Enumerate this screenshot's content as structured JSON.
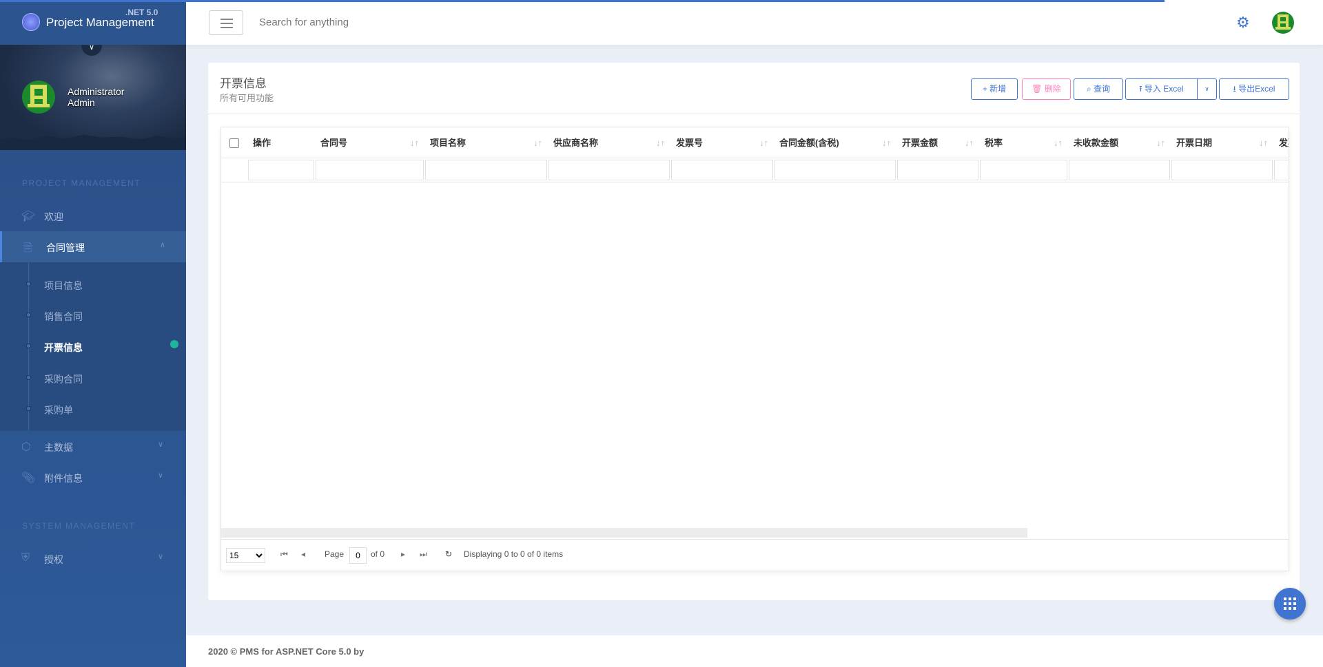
{
  "brand": {
    "title": "Project Management",
    "version": ".NET 5.0"
  },
  "user": {
    "name": "Administrator",
    "role": "Admin"
  },
  "sidebar": {
    "section1": "PROJECT MANAGEMENT",
    "section2": "SYSTEM MANAGEMENT",
    "items": [
      {
        "label": "欢迎",
        "icon": "graduation-cap-icon"
      },
      {
        "label": "合同管理",
        "icon": "file-icon"
      },
      {
        "label": "主数据",
        "icon": "cubes-icon"
      },
      {
        "label": "附件信息",
        "icon": "paperclip-icon"
      },
      {
        "label": "授权",
        "icon": "shield-icon"
      }
    ],
    "subitems": [
      {
        "label": "项目信息"
      },
      {
        "label": "销售合同"
      },
      {
        "label": "开票信息"
      },
      {
        "label": "采购合同"
      },
      {
        "label": "采购单"
      }
    ]
  },
  "topbar": {
    "search_placeholder": "Search for anything"
  },
  "page": {
    "title": "开票信息",
    "subtitle": "所有可用功能"
  },
  "toolbar": {
    "add": "新增",
    "delete": "删除",
    "query": "查询",
    "import": "导入 Excel",
    "export": "导出Excel"
  },
  "table": {
    "columns": [
      "操作",
      "合同号",
      "项目名称",
      "供应商名称",
      "发票号",
      "合同金额(含税)",
      "开票金额",
      "税率",
      "未收款金额",
      "开票日期",
      "发票"
    ]
  },
  "pager": {
    "page_size": "15",
    "page_label": "Page",
    "page": "0",
    "of": "of 0",
    "display": "Displaying 0 to 0 of 0 items"
  },
  "footer": {
    "text": "2020 © PMS for ASP.NET Core 5.0 by"
  },
  "colors": {
    "accent": "#3f74d1",
    "danger": "#fd7fbd",
    "badge": "#20b49c"
  }
}
